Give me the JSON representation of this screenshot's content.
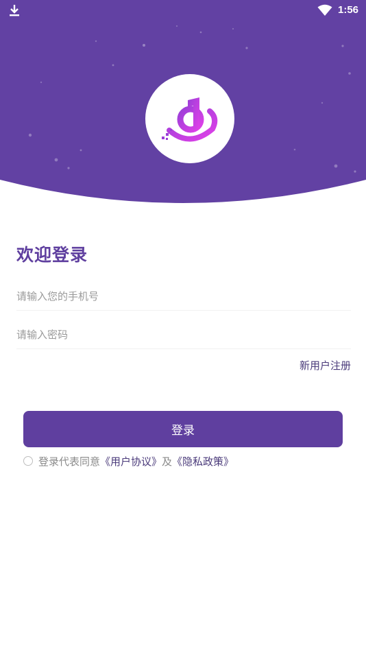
{
  "status_bar": {
    "time": "1:56",
    "icons": [
      "download-icon",
      "wifi-icon"
    ]
  },
  "header": {
    "background_color": "#6241a3",
    "logo_icon": "app-logo-icon",
    "logo_gradient": [
      "#9b3fd8",
      "#e040e8"
    ]
  },
  "login": {
    "title": "欢迎登录",
    "phone_placeholder": "请输入您的手机号",
    "password_placeholder": "请输入密码",
    "register_label": "新用户注册",
    "submit_label": "登录"
  },
  "agreement": {
    "prefix": "登录代表同意",
    "user_agreement": "《用户协议》",
    "conjunction": "及",
    "privacy_policy": "《隐私政策》",
    "checked": false
  },
  "colors": {
    "accent": "#5f3f9f",
    "link": "#4a3a7a",
    "placeholder": "#9a9a9a"
  }
}
